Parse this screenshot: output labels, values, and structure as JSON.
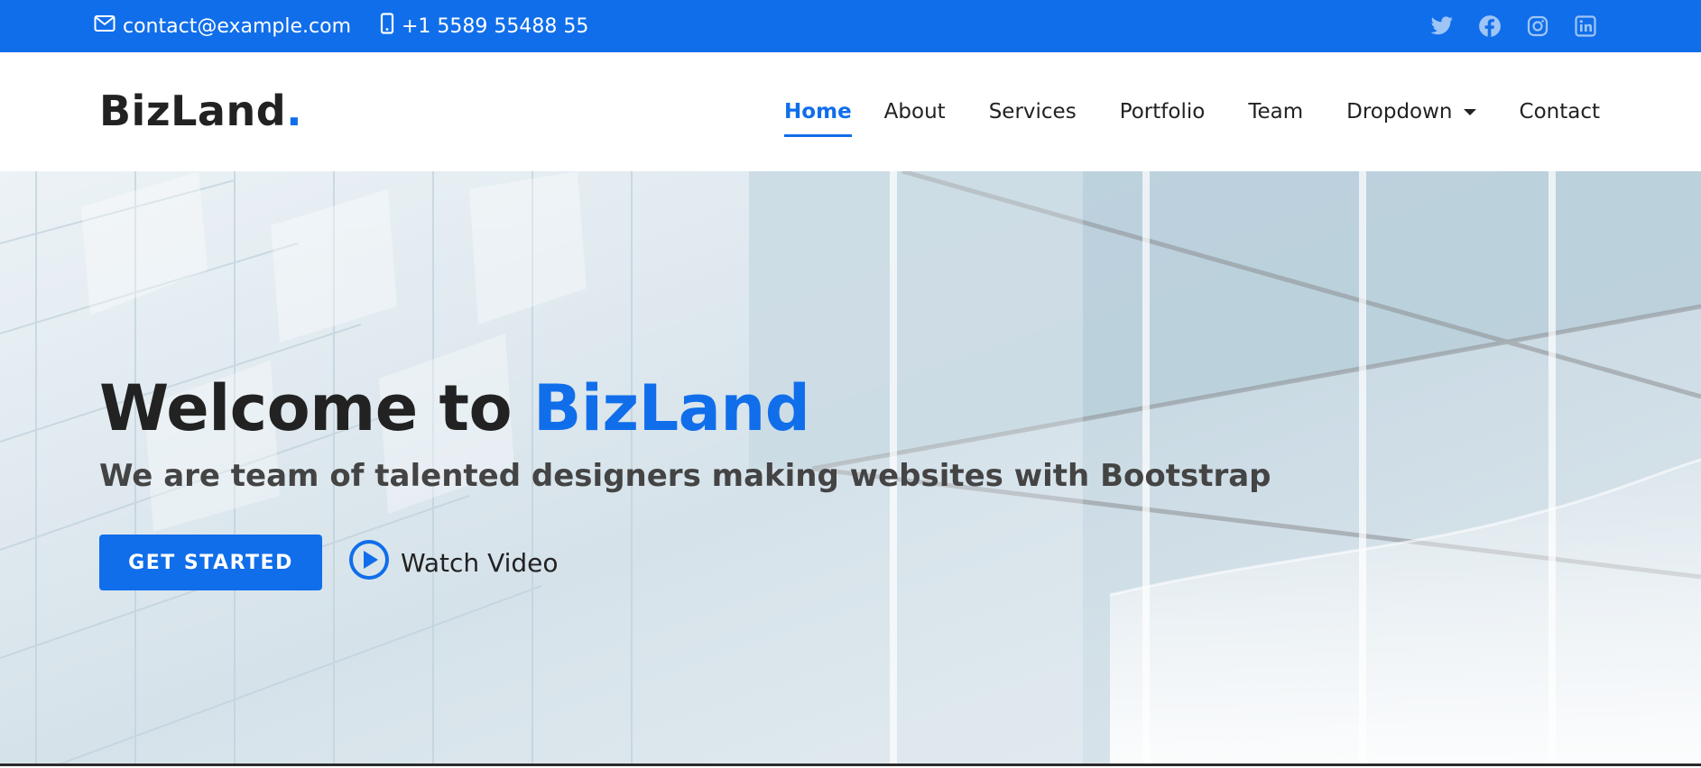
{
  "topbar": {
    "email": "contact@example.com",
    "phone": "+1 5589 55488 55",
    "social": [
      "twitter-icon",
      "facebook-icon",
      "instagram-icon",
      "linkedin-icon"
    ]
  },
  "header": {
    "logo": "BizLand",
    "logo_dot": ".",
    "nav": {
      "home": "Home",
      "about": "About",
      "services": "Services",
      "portfolio": "Portfolio",
      "team": "Team",
      "dropdown": "Dropdown",
      "contact": "Contact"
    }
  },
  "hero": {
    "title_prefix": "Welcome to ",
    "title_brand": "BizLand",
    "subtitle": "We are team of talented designers making websites with Bootstrap",
    "cta": "GET STARTED",
    "video": "Watch Video"
  },
  "colors": {
    "accent": "#106eea",
    "text": "#222222"
  }
}
